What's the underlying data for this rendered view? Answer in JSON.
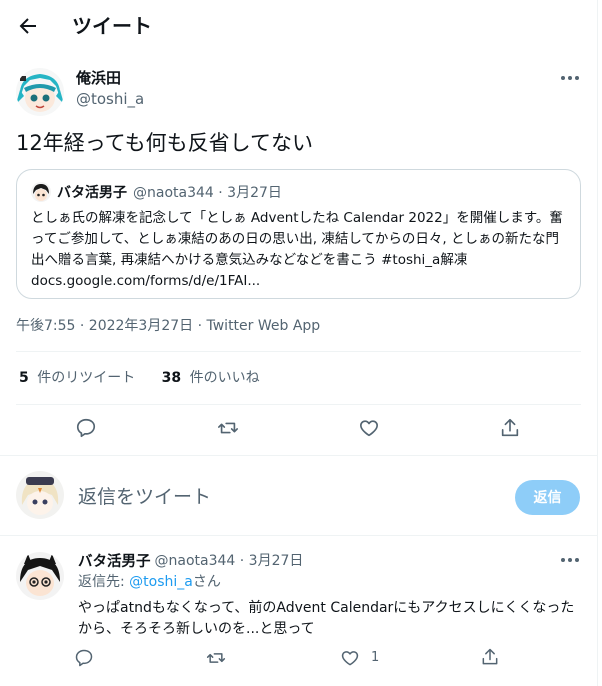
{
  "header": {
    "title": "ツイート"
  },
  "tweet": {
    "author_name": "俺浜田",
    "author_handle": "@toshi_a",
    "text": "12年経っても何も反省してない",
    "timestamp": "午後7:55 · 2022年3月27日 · Twitter Web App",
    "retweet_count": "5",
    "retweet_label": "件のリツイート",
    "like_count": "38",
    "like_label": "件のいいね"
  },
  "quote": {
    "author_name": "バタ活男子",
    "author_handle": "@naota344 · 3月27日",
    "text": "としぁ氏の解凍を記念して「としぁ Adventしたね Calendar 2022」を開催します。奮ってご参加して、としぁ凍結のあの日の思い出, 凍結してからの日々, としぁの新たな門出へ贈る言葉, 再凍結へかける意気込みなどなどを書こう #toshi_a解凍 docs.google.com/forms/d/e/1FAI..."
  },
  "compose": {
    "placeholder": "返信をツイート",
    "button_label": "返信"
  },
  "reply": {
    "author_name": "バタ活男子",
    "author_handle": "@naota344 · 3月27日",
    "replying_prefix": "返信先: ",
    "replying_mention": "@toshi_a",
    "replying_suffix": "さん",
    "text": "やっぱatndもなくなって、前のAdvent Calendarにもアクセスしにくくなったから、そろそろ新しいのを...と思って",
    "like_count": "1"
  },
  "colors": {
    "accent": "#1d9bf0",
    "reply_button": "#8ecdf8",
    "secondary_text": "#536471",
    "border": "#eff3f4"
  },
  "icons": [
    "back-arrow-icon",
    "more-icon",
    "reply-icon",
    "retweet-icon",
    "like-icon",
    "share-icon"
  ]
}
